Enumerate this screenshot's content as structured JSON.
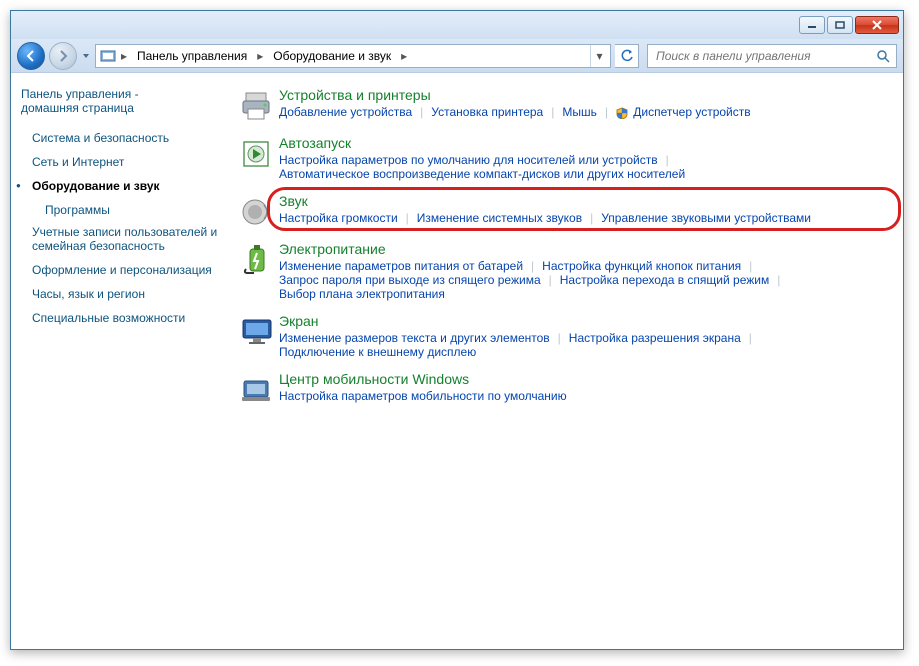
{
  "breadcrumb": {
    "root": "Панель управления",
    "current": "Оборудование и звук"
  },
  "search": {
    "placeholder": "Поиск в панели управления"
  },
  "sidebar": {
    "home_line1": "Панель управления -",
    "home_line2": "домашняя страница",
    "items": [
      {
        "label": "Система и безопасность",
        "active": false
      },
      {
        "label": "Сеть и Интернет",
        "active": false
      },
      {
        "label": "Оборудование и звук",
        "active": true
      },
      {
        "label": "Программы",
        "active": false,
        "sub": true
      },
      {
        "label": "Учетные записи пользователей и семейная безопасность",
        "active": false
      },
      {
        "label": "Оформление и персонализация",
        "active": false
      },
      {
        "label": "Часы, язык и регион",
        "active": false
      },
      {
        "label": "Специальные возможности",
        "active": false
      }
    ]
  },
  "categories": [
    {
      "title": "Устройства и принтеры",
      "icon": "printer",
      "links": [
        "Добавление устройства",
        "Установка принтера",
        "Мышь",
        "🛡 Диспетчер устройств"
      ]
    },
    {
      "title": "Автозапуск",
      "icon": "autoplay",
      "links": [
        "Настройка параметров по умолчанию для носителей или устройств",
        "Автоматическое воспроизведение компакт-дисков или других носителей"
      ]
    },
    {
      "title": "Звук",
      "icon": "sound",
      "highlighted": true,
      "links": [
        "Настройка громкости",
        "Изменение системных звуков",
        "Управление звуковыми устройствами"
      ]
    },
    {
      "title": "Электропитание",
      "icon": "power",
      "links": [
        "Изменение параметров питания от батарей",
        "Настройка функций кнопок питания",
        "Запрос пароля при выходе из спящего режима",
        "Настройка перехода в спящий режим",
        "Выбор плана электропитания"
      ]
    },
    {
      "title": "Экран",
      "icon": "display",
      "links": [
        "Изменение размеров текста и других элементов",
        "Настройка разрешения экрана",
        "Подключение к внешнему дисплею"
      ]
    },
    {
      "title": "Центр мобильности Windows",
      "icon": "mobility",
      "links": [
        "Настройка параметров мобильности по умолчанию"
      ]
    }
  ]
}
